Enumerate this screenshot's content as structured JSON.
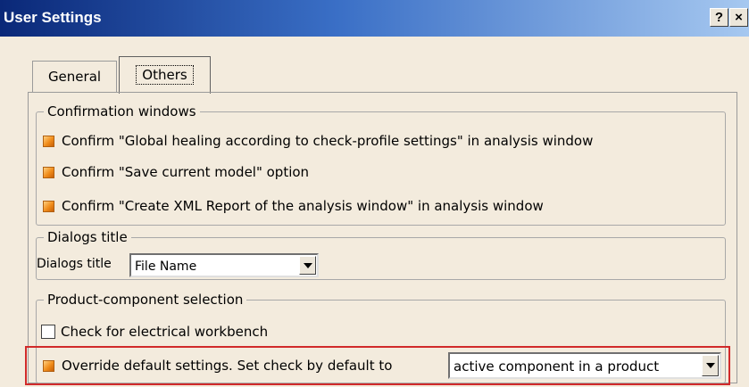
{
  "window": {
    "title": "User Settings",
    "help_label": "?",
    "close_label": "×"
  },
  "tabs": [
    {
      "label": "General",
      "active": false
    },
    {
      "label": "Others",
      "active": true
    }
  ],
  "confirmation": {
    "legend": "Confirmation windows",
    "items": [
      {
        "label": "Confirm \"Global healing according to check-profile settings\" in analysis window",
        "checked": true
      },
      {
        "label": "Confirm \"Save current model\" option",
        "checked": true
      },
      {
        "label": "Confirm \"Create XML Report of the analysis window\" in analysis window",
        "checked": true
      }
    ]
  },
  "dialogs_title": {
    "legend": "Dialogs title",
    "field_label": "Dialogs title",
    "selected": "File Name"
  },
  "product_selection": {
    "legend": "Product-component selection",
    "electrical_label": "Check for electrical workbench",
    "electrical_checked": false,
    "override_label": "Override default settings. Set check by default to",
    "override_checked": true,
    "default_selected": "active component in a product"
  },
  "colors": {
    "highlight": "#d12a2a",
    "checkbox_accent": "#f08c1a",
    "title_bar": "#0a2878"
  }
}
